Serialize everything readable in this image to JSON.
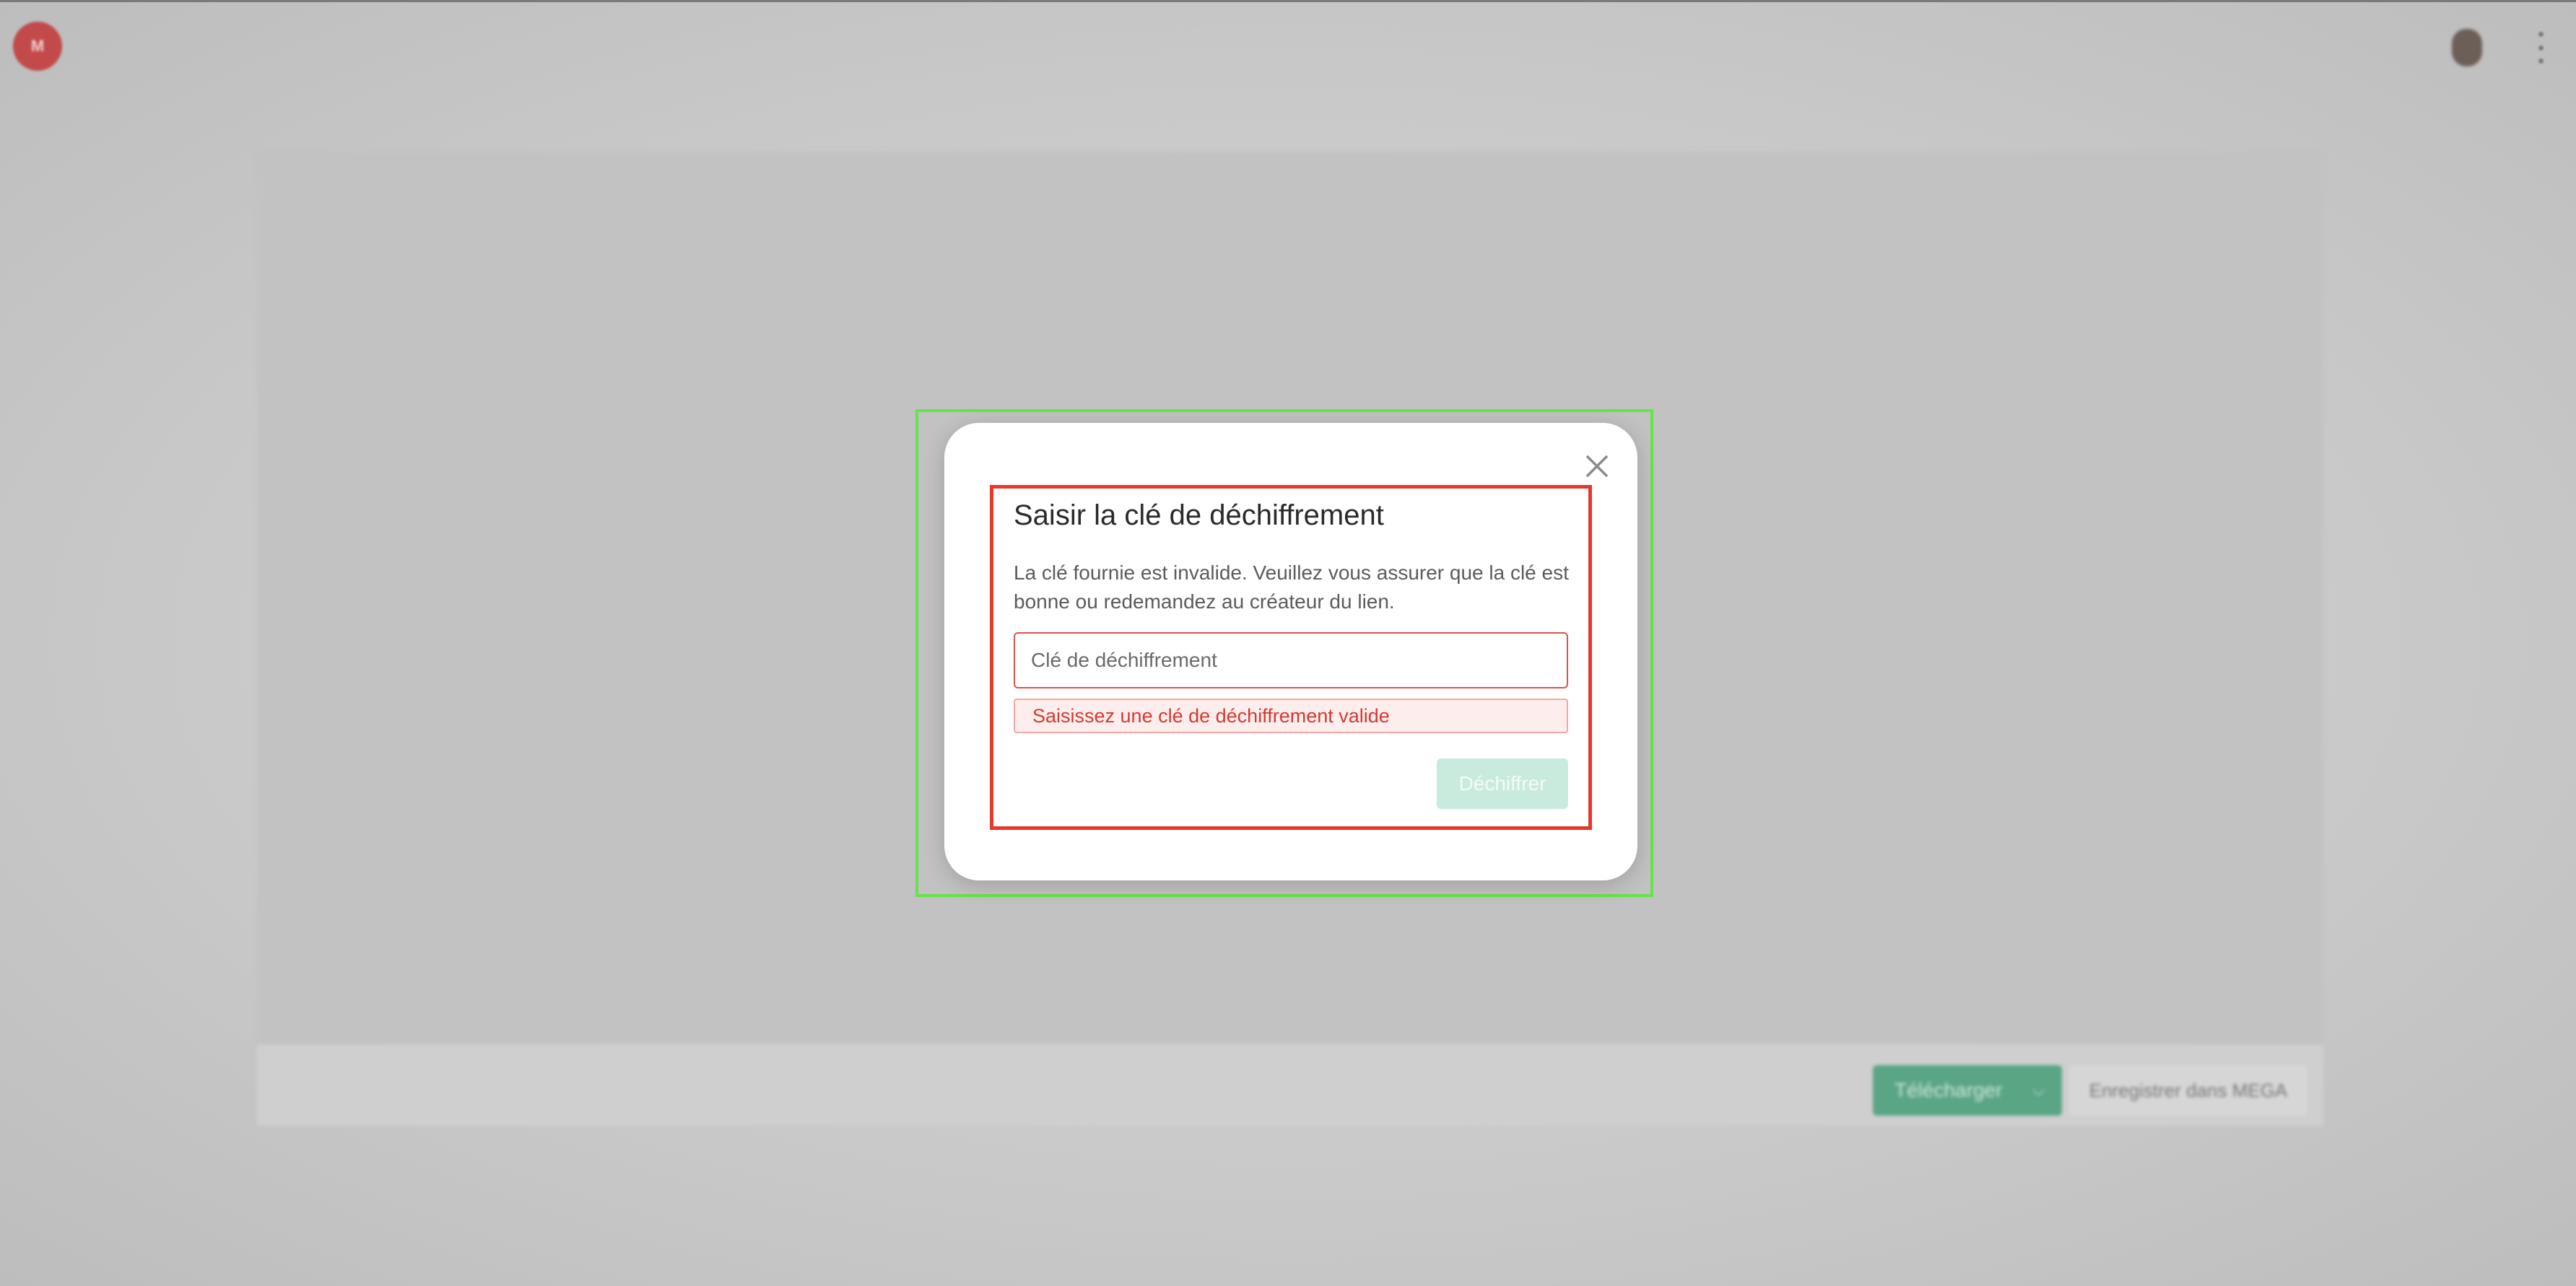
{
  "app": {
    "logo_text": "M"
  },
  "bottom_bar": {
    "download_label": "Télécharger",
    "save_to_mega_label": "Enregistrer dans MEGA"
  },
  "dialog": {
    "title": "Saisir la clé de déchiffrement",
    "message": "La clé fournie est invalide. Veuillez vous assurer que la clé est bonne ou redemandez au créateur du lien.",
    "input_placeholder": "Clé de déchiffrement",
    "input_value": "",
    "error_message": "Saisissez une clé de déchiffrement valide",
    "decrypt_label": "Déchiffrer",
    "decrypt_enabled": false
  },
  "colors": {
    "accent_green": "#5aa584",
    "error_red": "#d23a33",
    "annotation_outer": "#66e34a",
    "annotation_inner": "#e5392d"
  },
  "icons": {
    "logo": "mega-logo-icon",
    "close": "close-icon",
    "menu": "kebab-menu-icon",
    "dropdown": "chevron-down-icon"
  }
}
